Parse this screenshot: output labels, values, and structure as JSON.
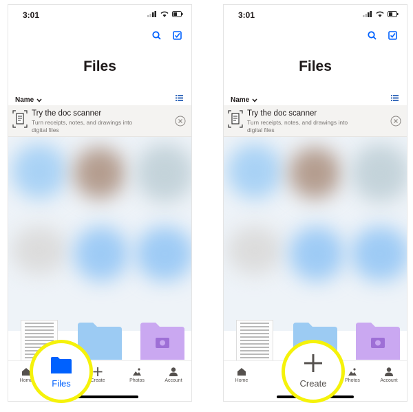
{
  "status": {
    "time": "3:01"
  },
  "page": {
    "title": "Files"
  },
  "sort": {
    "label": "Name"
  },
  "banner": {
    "title": "Try the doc scanner",
    "subtitle": "Turn receipts, notes, and drawings into digital files"
  },
  "tabs": {
    "home": "Home",
    "files": "Files",
    "create": "Create",
    "photos": "Photos",
    "account": "Account"
  },
  "highlights": {
    "left": "Files",
    "right": "Create"
  },
  "colors": {
    "accent": "#0061fe",
    "highlight_ring": "#f5f20a",
    "folder_blue": "#9ccbf3",
    "folder_purple": "#caa8f1"
  },
  "icons": [
    "search-icon",
    "select-icon",
    "chevron-down-icon",
    "list-view-icon",
    "doc-scanner-icon",
    "close-icon",
    "home-icon",
    "folder-icon",
    "plus-icon",
    "photos-icon",
    "account-icon"
  ]
}
